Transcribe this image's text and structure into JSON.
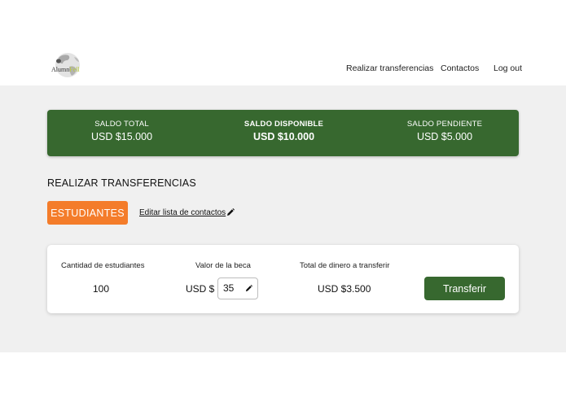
{
  "brand": {
    "name_part1": "Alumn",
    "name_part2": "Fell"
  },
  "nav": {
    "transfers": "Realizar transferencias",
    "contacts": "Contactos",
    "logout": "Log out"
  },
  "balance": {
    "total_label": "SALDO TOTAL",
    "total_value": "USD $15.000",
    "available_label": "SALDO DISPONIBLE",
    "available_value": "USD $10.000",
    "pending_label": "SALDO PENDIENTE",
    "pending_value": "USD $5.000"
  },
  "section_title": "REALIZAR TRANSFERENCIAS",
  "tab_students": "ESTUDIANTES",
  "edit_contacts_label": "Editar lista de contactos",
  "card": {
    "student_count_label": "Cantidad de estudiantes",
    "student_count_value": "100",
    "scholarship_label": "Valor de la beca",
    "currency_prefix": "USD $",
    "scholarship_value": "35",
    "total_label": "Total de dinero a transferir",
    "total_value": "USD $3.500",
    "transfer_button": "Transferir"
  },
  "colors": {
    "primary_green": "#37682f",
    "accent_orange": "#f47c2a",
    "background_gray": "#f0f0f0"
  },
  "icons": {
    "logo": "globe-icon",
    "edit": "pencil-icon"
  }
}
